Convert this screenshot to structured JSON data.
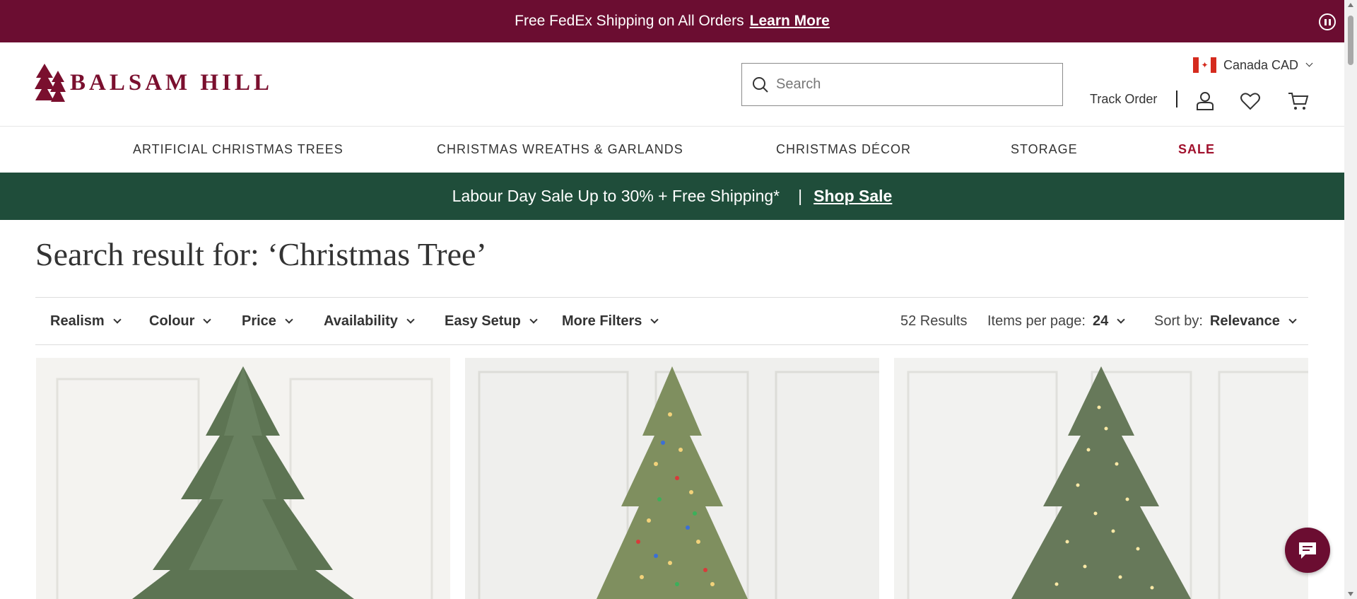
{
  "promo": {
    "text": "Free FedEx Shipping on All Orders",
    "link": "Learn More"
  },
  "header": {
    "logo_text": "BALSAM HILL",
    "search_placeholder": "Search",
    "currency": "Canada CAD",
    "track_order": "Track Order"
  },
  "nav": {
    "items": [
      {
        "label": "ARTIFICIAL CHRISTMAS TREES"
      },
      {
        "label": "CHRISTMAS WREATHS & GARLANDS"
      },
      {
        "label": "CHRISTMAS DÉCOR"
      },
      {
        "label": "STORAGE"
      },
      {
        "label": "SALE"
      }
    ]
  },
  "sale_banner": {
    "text": "Labour Day Sale Up to 30% + Free Shipping*",
    "separator": "|",
    "link": "Shop Sale"
  },
  "page": {
    "title": "Search result for: ‘Christmas Tree’"
  },
  "filters": {
    "items": [
      {
        "label": "Realism"
      },
      {
        "label": "Colour"
      },
      {
        "label": "Price"
      },
      {
        "label": "Availability"
      },
      {
        "label": "Easy Setup"
      },
      {
        "label": "More Filters"
      }
    ],
    "results": "52 Results",
    "items_per_page_label": "Items per page:",
    "items_per_page_value": "24",
    "sort_label": "Sort by:",
    "sort_value": "Relevance"
  },
  "colors": {
    "brand": "#6b0d31",
    "sale_green": "#1f4d3a",
    "sale_red": "#a0102c"
  }
}
